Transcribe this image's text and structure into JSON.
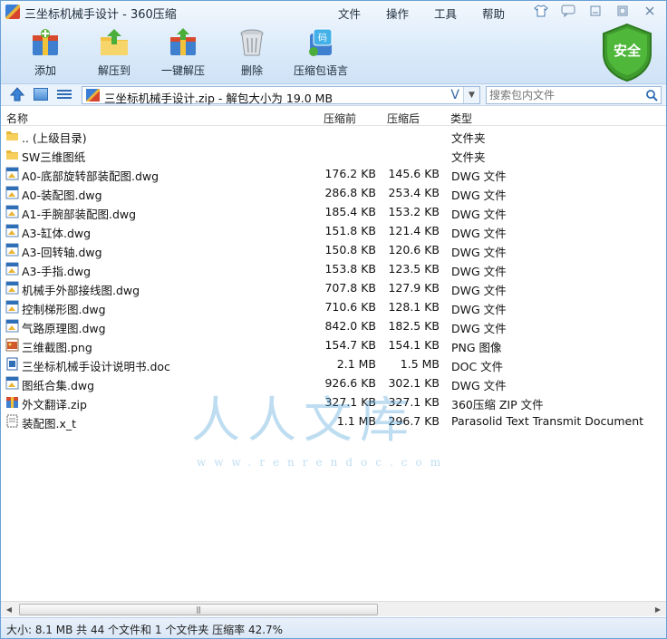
{
  "window": {
    "title": "三坐标机械手设计 - 360压缩"
  },
  "menu": [
    "文件",
    "操作",
    "工具",
    "帮助"
  ],
  "toolbar": [
    {
      "label": "添加",
      "icon": "add-archive-icon"
    },
    {
      "label": "解压到",
      "icon": "extract-to-icon"
    },
    {
      "label": "一键解压",
      "icon": "one-click-extract-icon"
    },
    {
      "label": "删除",
      "icon": "delete-trash-icon"
    },
    {
      "label": "压缩包语言",
      "icon": "archive-language-icon"
    }
  ],
  "security_badge": {
    "label": "安全",
    "color": "#3f9b2e"
  },
  "addressbar": {
    "path": "三坐标机械手设计.zip - 解包大小为 19.0 MB",
    "search_placeholder": "搜索包内文件"
  },
  "columns": {
    "name": "名称",
    "size": "压缩前",
    "csize": "压缩后",
    "type": "类型"
  },
  "files": [
    {
      "name": ".. (上级目录)",
      "size": "",
      "csize": "",
      "type": "文件夹",
      "icon": "folder"
    },
    {
      "name": "SW三维图纸",
      "size": "",
      "csize": "",
      "type": "文件夹",
      "icon": "folder"
    },
    {
      "name": "A0-底部旋转部装配图.dwg",
      "size": "176.2 KB",
      "csize": "145.6 KB",
      "type": "DWG 文件",
      "icon": "dwg"
    },
    {
      "name": "A0-装配图.dwg",
      "size": "286.8 KB",
      "csize": "253.4 KB",
      "type": "DWG 文件",
      "icon": "dwg"
    },
    {
      "name": "A1-手腕部装配图.dwg",
      "size": "185.4 KB",
      "csize": "153.2 KB",
      "type": "DWG 文件",
      "icon": "dwg"
    },
    {
      "name": "A3-缸体.dwg",
      "size": "151.8 KB",
      "csize": "121.4 KB",
      "type": "DWG 文件",
      "icon": "dwg"
    },
    {
      "name": "A3-回转轴.dwg",
      "size": "150.8 KB",
      "csize": "120.6 KB",
      "type": "DWG 文件",
      "icon": "dwg"
    },
    {
      "name": "A3-手指.dwg",
      "size": "153.8 KB",
      "csize": "123.5 KB",
      "type": "DWG 文件",
      "icon": "dwg"
    },
    {
      "name": "机械手外部接线图.dwg",
      "size": "707.8 KB",
      "csize": "127.9 KB",
      "type": "DWG 文件",
      "icon": "dwg"
    },
    {
      "name": "控制梯形图.dwg",
      "size": "710.6 KB",
      "csize": "128.1 KB",
      "type": "DWG 文件",
      "icon": "dwg"
    },
    {
      "name": "气路原理图.dwg",
      "size": "842.0 KB",
      "csize": "182.5 KB",
      "type": "DWG 文件",
      "icon": "dwg"
    },
    {
      "name": "三维截图.png",
      "size": "154.7 KB",
      "csize": "154.1 KB",
      "type": "PNG 图像",
      "icon": "png"
    },
    {
      "name": "三坐标机械手设计说明书.doc",
      "size": "2.1 MB",
      "csize": "1.5 MB",
      "type": "DOC 文件",
      "icon": "doc"
    },
    {
      "name": "图纸合集.dwg",
      "size": "926.6 KB",
      "csize": "302.1 KB",
      "type": "DWG 文件",
      "icon": "dwg"
    },
    {
      "name": "外文翻译.zip",
      "size": "327.1 KB",
      "csize": "327.1 KB",
      "type": "360压缩 ZIP 文件",
      "icon": "zip"
    },
    {
      "name": "装配图.x_t",
      "size": "1.1 MB",
      "csize": "296.7 KB",
      "type": "Parasolid Text Transmit Document",
      "icon": "xt"
    }
  ],
  "watermark": {
    "text": "人人文库",
    "url": "www.renrendoc.com"
  },
  "status": "大小: 8.1 MB 共 44 个文件和 1 个文件夹 压缩率 42.7%"
}
